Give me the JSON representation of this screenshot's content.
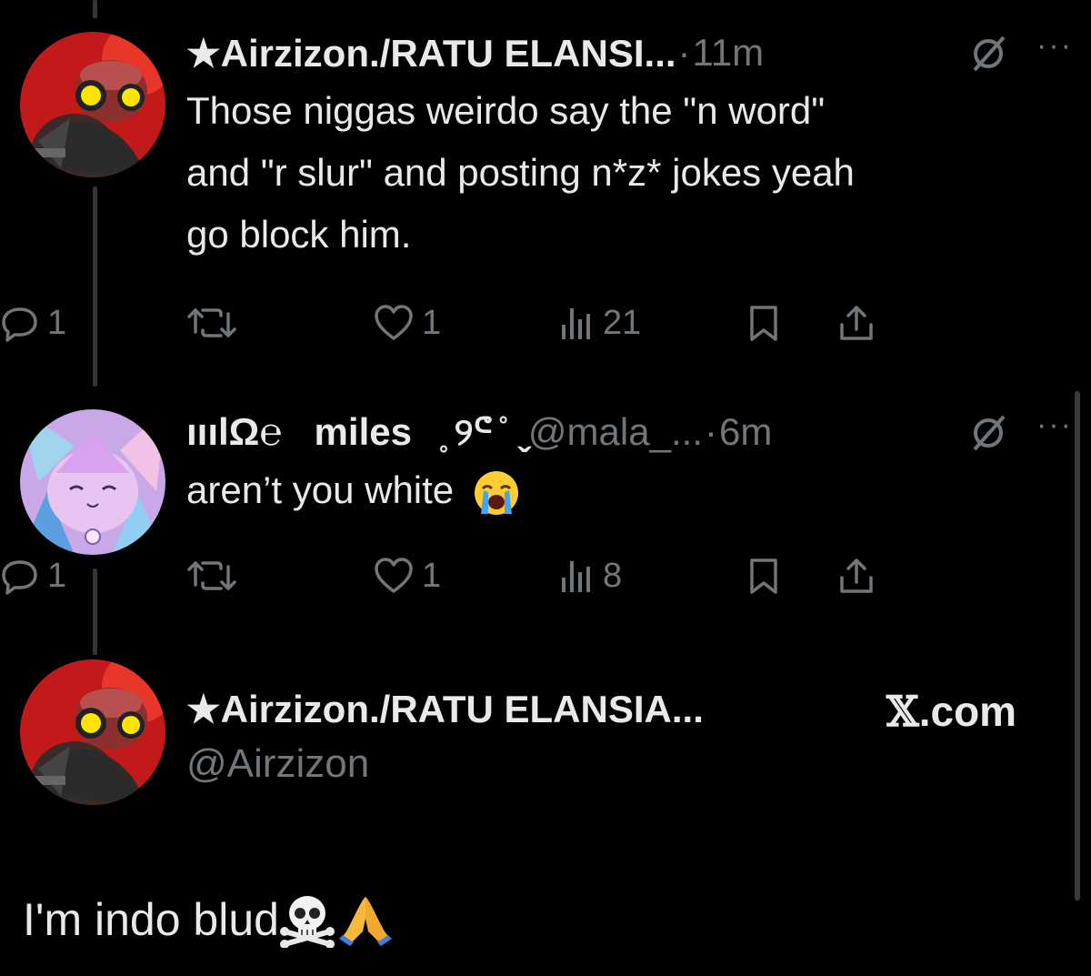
{
  "tweets": [
    {
      "display_name": "★Airzizon./RATU ELANSI...",
      "handle": "",
      "time": "11m",
      "text_lines": [
        "Those niggas weirdo say the \"n word\"",
        "and \"r slur\" and posting n*z* jokes yeah",
        "go block him."
      ],
      "replies": "1",
      "reposts": "",
      "likes": "1",
      "views": "21"
    },
    {
      "display_name": "ııılΩ℮   miles   ̥ ୨ᕪ ̊  ̬",
      "handle": "@mala_...",
      "time": "6m",
      "text": "aren’t you white",
      "replies": "1",
      "reposts": "",
      "likes": "1",
      "views": "8"
    }
  ],
  "card": {
    "display_name": "★Airzizon./RATU ELANSIA...",
    "handle": "@Airzizon",
    "site_glyph": "𝕏",
    "site_text": ".com",
    "caption": "I'm indo blud"
  },
  "icons": {
    "reply": "reply-icon",
    "repost": "repost-icon",
    "like": "heart-icon",
    "views": "views-icon",
    "bookmark": "bookmark-icon",
    "share": "share-icon",
    "grok": "grok-icon",
    "more": "more-icon",
    "crying": "loudly-crying-emoji",
    "skull": "skull-crossbones-emoji",
    "pray": "folded-hands-emoji"
  },
  "colors": {
    "background": "#000000",
    "text": "#e7e9ea",
    "muted": "#71767b",
    "thread_line": "#333639"
  }
}
